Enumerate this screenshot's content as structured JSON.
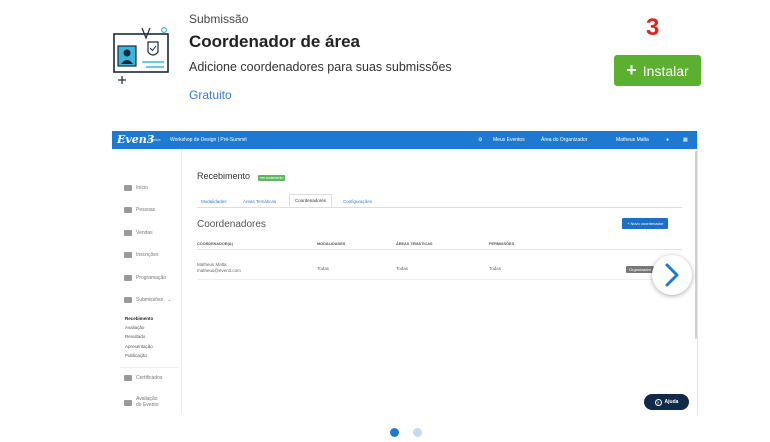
{
  "app": {
    "category": "Submissão",
    "title": "Coordenador de área",
    "description": "Adicione coordenadores para suas submissões",
    "price": "Gratuito",
    "marker": "3",
    "install_label": "Instalar",
    "icon": "coordinator-badge-icon"
  },
  "preview": {
    "nav": {
      "logo": "Even3",
      "logo_sub": "Eventos",
      "event_title": "Workshop de Design | Pré-Summit",
      "items": [
        "Meus Eventos",
        "Área do Organizador",
        "Matheus Malta"
      ]
    },
    "sidebar": {
      "items": [
        "Início",
        "Pessoas",
        "Vendas",
        "Inscrições",
        "Programação",
        "Submissões",
        "Certificados",
        "Avaliação do Evento"
      ],
      "sub_items": [
        "Recebimento",
        "Avaliação",
        "Resultado",
        "Apresentação",
        "Publicação"
      ]
    },
    "heading": "Recebimento",
    "badge": "em andamento",
    "tabs": [
      "Modalidades",
      "Áreas Temáticas",
      "Coordenadores",
      "Configurações"
    ],
    "active_tab": "Coordenadores",
    "section_title": "Coordenadores",
    "new_button": "+ Novo coordenador",
    "table": {
      "headers": [
        "COORDENADOR(A)",
        "MODALIDADES",
        "ÁREAS TEMÁTICAS",
        "PERMISSÕES"
      ],
      "row": {
        "name": "Matheus Malta",
        "email": "matheus@even3.com",
        "modalidades": "Todas",
        "areas": "Todas",
        "permissoes": "Todas",
        "role": "Organizador"
      }
    },
    "help_label": "Ajuda"
  },
  "carousel": {
    "count": 2,
    "active_index": 0
  },
  "colors": {
    "brand_blue": "#1e7ad1",
    "install_green": "#5cb030",
    "marker_red": "#e2231a"
  }
}
